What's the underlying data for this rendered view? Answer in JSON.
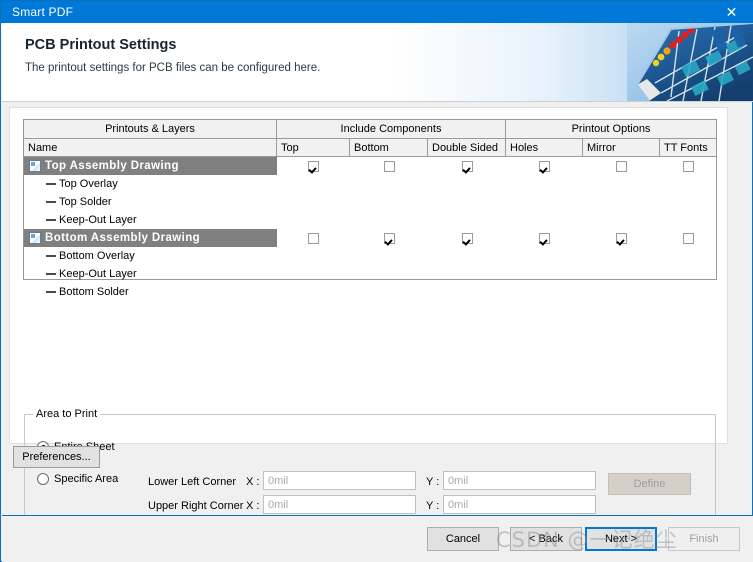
{
  "window": {
    "title": "Smart PDF",
    "close_icon": "close-icon",
    "titlebar_color": "#0078d7"
  },
  "banner": {
    "heading": "PCB Printout Settings",
    "subheading": "The printout settings for PCB files can be configured here.",
    "art_icon": "pcb-board-image"
  },
  "grid": {
    "group_headers": [
      {
        "label": "Printouts & Layers"
      },
      {
        "label": "Include Components"
      },
      {
        "label": "Printout Options"
      }
    ],
    "columns": [
      {
        "label": "Name"
      },
      {
        "label": "Top"
      },
      {
        "label": "Bottom"
      },
      {
        "label": "Double Sided"
      },
      {
        "label": "Holes"
      },
      {
        "label": "Mirror"
      },
      {
        "label": "TT Fonts"
      }
    ],
    "rows": [
      {
        "name": "Top Assembly Drawing",
        "type": "printout",
        "selected": true,
        "icon": "document-icon",
        "checks": [
          true,
          false,
          true,
          true,
          false,
          false
        ]
      },
      {
        "name": "Top Overlay",
        "type": "layer",
        "icon": "layer-dash-icon"
      },
      {
        "name": "Top Solder",
        "type": "layer",
        "icon": "layer-dash-icon"
      },
      {
        "name": "Keep-Out Layer",
        "type": "layer",
        "icon": "layer-dash-icon"
      },
      {
        "name": "Bottom Assembly Drawing",
        "type": "printout",
        "selected": true,
        "icon": "document-icon",
        "checks": [
          false,
          true,
          true,
          true,
          true,
          false
        ]
      },
      {
        "name": "Bottom Overlay",
        "type": "layer",
        "icon": "layer-dash-icon"
      },
      {
        "name": "Keep-Out Layer",
        "type": "layer",
        "icon": "layer-dash-icon"
      },
      {
        "name": "Bottom Solder",
        "type": "layer",
        "icon": "layer-dash-icon"
      }
    ]
  },
  "area_to_print": {
    "legend": "Area to Print",
    "entire_sheet": {
      "label": "Entire Sheet",
      "selected": true
    },
    "specific_area": {
      "label": "Specific Area",
      "selected": false
    },
    "lower_left": {
      "label": "Lower Left Corner",
      "x_label": "X :",
      "y_label": "Y :",
      "x_placeholder": "0mil",
      "y_placeholder": "0mil",
      "x_value": "",
      "y_value": ""
    },
    "upper_right": {
      "label": "Upper Right Corner",
      "x_label": "X :",
      "y_label": "Y :",
      "x_placeholder": "0mil",
      "y_placeholder": "0mil",
      "x_value": "",
      "y_value": ""
    },
    "define_button": {
      "label": "Define",
      "enabled": false
    }
  },
  "preferences_button": {
    "label": "Preferences..."
  },
  "footer": {
    "cancel": "Cancel",
    "back": "< Back",
    "next": "Next >",
    "finish": "Finish"
  },
  "watermark": "CSDN @一记绝尘"
}
